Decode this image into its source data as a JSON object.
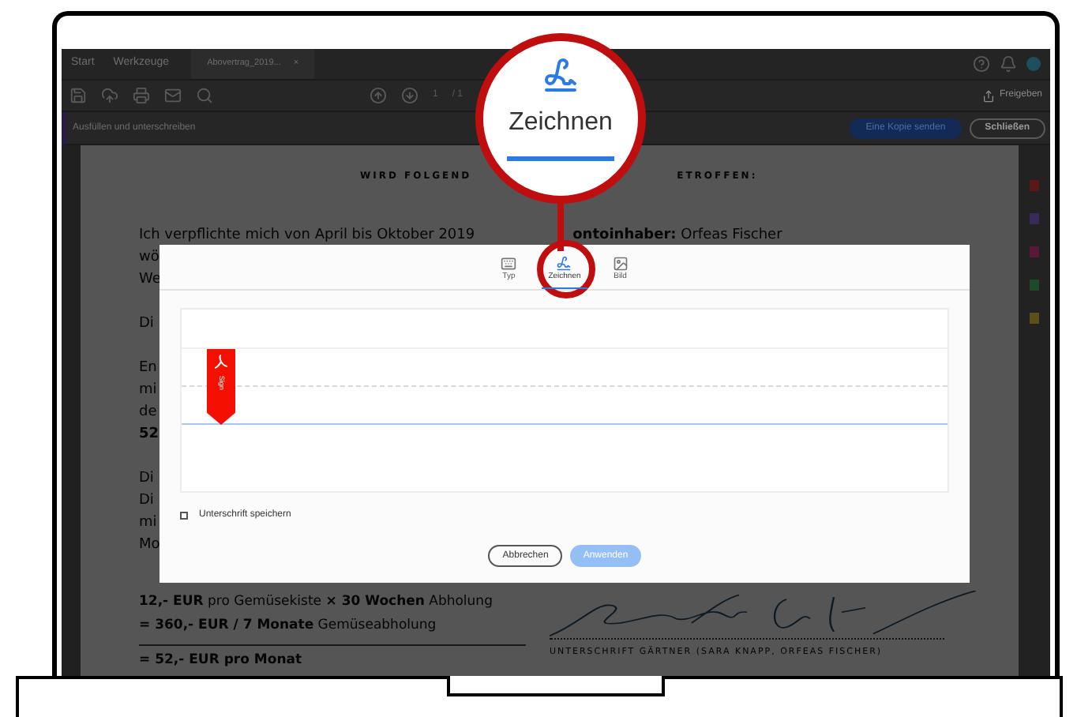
{
  "menu_bar": {
    "items": [
      "Start",
      "Werkzeuge"
    ],
    "document_tab": {
      "label": "Abovertrag_2019...",
      "close": "×"
    }
  },
  "toolbar": {
    "page_number": "1",
    "page_total": "/ 1",
    "share": "Freigeben"
  },
  "fill_sign_bar": {
    "title": "Ausfüllen und unterschreiben",
    "send_copy": "Eine Kopie senden",
    "close": "Schließen"
  },
  "document": {
    "heading_left": "WIRD FOLGEND",
    "heading_right": "ETROFFEN:",
    "intro": "Ich verpflichte mich von April bis Oktober 2019",
    "account_holder": "**ontoinhaber:** Orfeas Fischer",
    "paragraphs": [
      [
        "wö",
        "We"
      ],
      [
        "Di"
      ],
      [
        "En",
        "mi",
        "de",
        "**52**"
      ],
      [
        "Di",
        "Di",
        "mi",
        "Mo"
      ]
    ],
    "calc_lines": [
      "**12,- EUR** pro Gemüsekiste **× 30 Wochen** Abholung",
      "**= 360,- EUR / 7 Monate** Gemüseabholung"
    ],
    "total": "= 52,- EUR pro Monat",
    "signature_caption": "UNTERSCHRIFT GÄRTNER (SARA KNAPP, ORFEAS FISCHER)"
  },
  "dialog": {
    "tabs": [
      {
        "label": "Typ",
        "kind": "keyboard",
        "selected": false
      },
      {
        "label": "Zeichnen",
        "kind": "pen",
        "selected": true
      },
      {
        "label": "Bild",
        "kind": "image",
        "selected": false
      }
    ],
    "sign_marker": "Sign",
    "save_signature": {
      "label": "Unterschrift speichern",
      "checked": false
    },
    "buttons": [
      {
        "label": "Abbrechen",
        "kind": "secondary",
        "disabled": false
      },
      {
        "label": "Anwenden",
        "kind": "primary",
        "disabled": true
      }
    ]
  },
  "callout": {
    "label": "Zeichnen"
  }
}
